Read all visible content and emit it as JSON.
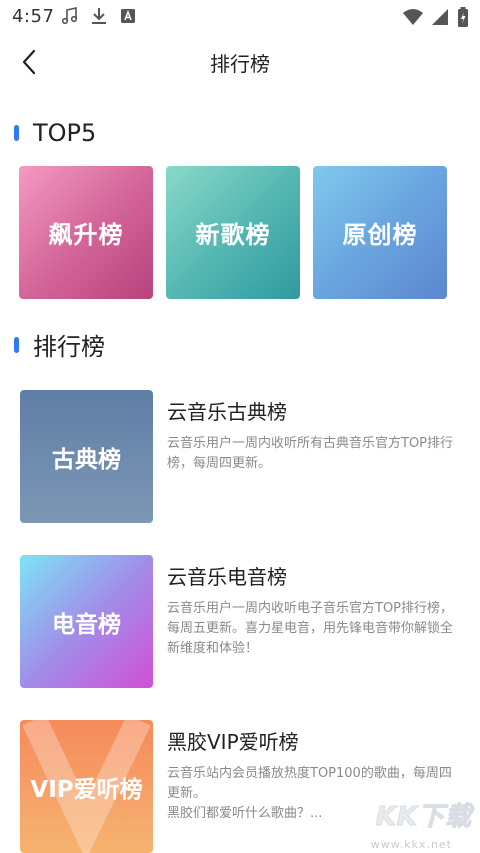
{
  "status_bar": {
    "time": "4:57",
    "left_icons": [
      "music-note-icon",
      "download-icon",
      "a-box-icon"
    ],
    "right_icons": [
      "wifi-icon",
      "signal-icon",
      "battery-charging-icon"
    ]
  },
  "header": {
    "back_icon": "chevron-left-icon",
    "title": "排行榜"
  },
  "top5": {
    "section_title": "TOP5",
    "cards": [
      {
        "label": "飙升榜"
      },
      {
        "label": "新歌榜"
      },
      {
        "label": "原创榜"
      }
    ]
  },
  "ranking": {
    "section_title": "排行榜",
    "items": [
      {
        "cover_label": "古典榜",
        "title": "云音乐古典榜",
        "desc": "云音乐用户一周内收听所有古典音乐官方TOP排行榜，每周四更新。"
      },
      {
        "cover_label": "电音榜",
        "title": "云音乐电音榜",
        "desc": "云音乐用户一周内收听电子音乐官方TOP排行榜，每周五更新。喜力星电音，用先锋电音带你解锁全新维度和体验！"
      },
      {
        "cover_label": "VIP爱听榜",
        "title": "黑胶VIP爱听榜",
        "desc": "云音乐站内会员播放热度TOP100的歌曲，每周四更新。",
        "desc2": "黑胶们都爱听什么歌曲？..."
      }
    ]
  },
  "watermark": {
    "main": "KK下载",
    "url": "www.kkx.net"
  },
  "colors": {
    "accent": "#2f7bf5",
    "title_text": "#222222",
    "desc_text": "#8a8a8a"
  }
}
